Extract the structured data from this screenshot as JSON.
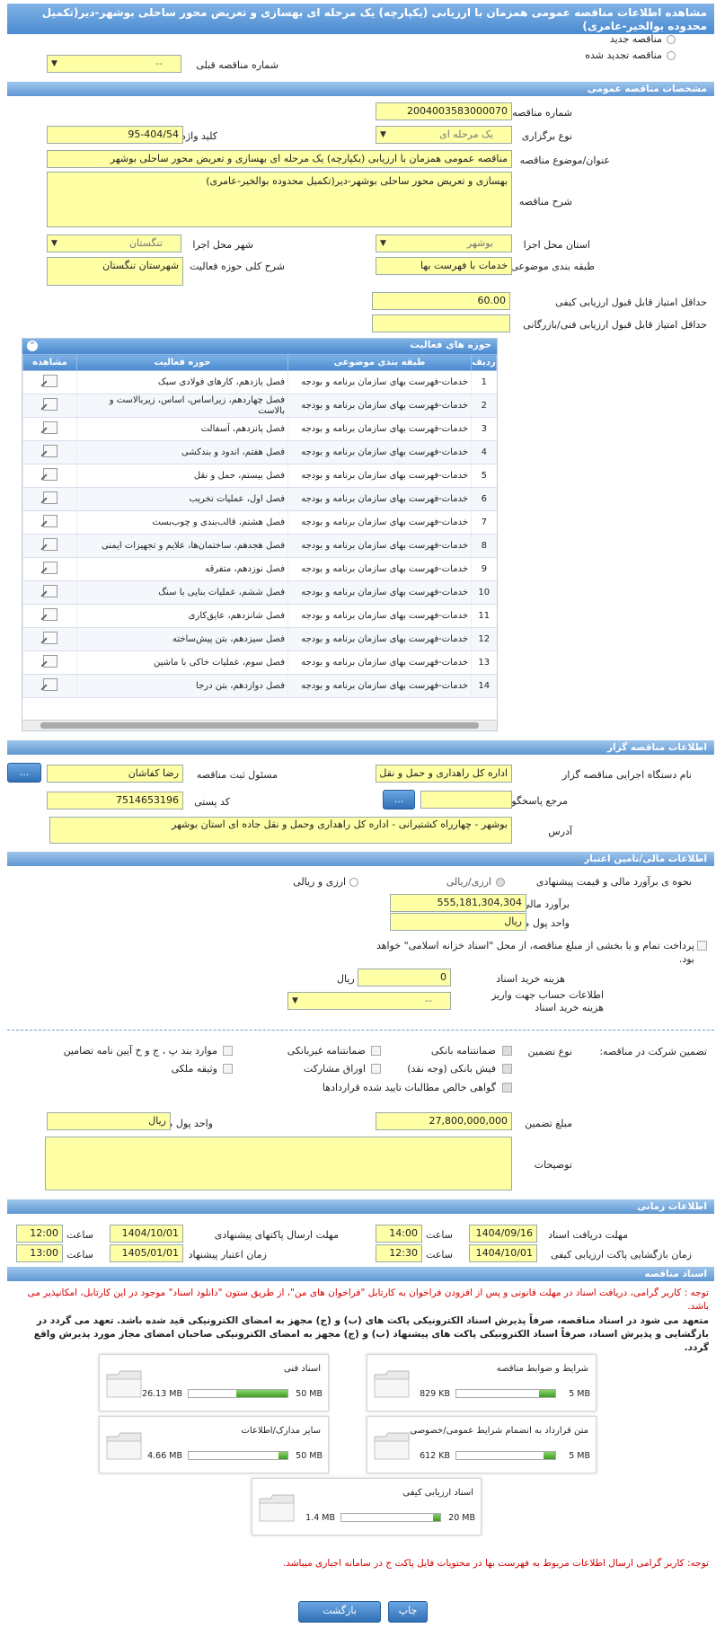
{
  "page_title": "مشاهده اطلاعات مناقصه عمومی همزمان با ارزیابی (یکپارچه) یک مرحله ای بهسازی و تعریض محور ساحلی بوشهر-دیر(تکمیل محدوده بوالخیر-عامری)",
  "top": {
    "new_tender": "مناقصه جدید",
    "renewed_tender": "مناقصه تجدید شده",
    "prev_number_label": "شماره مناقصه قبلی",
    "prev_number_value": "--"
  },
  "general": {
    "header": "مشخصات مناقصه عمومی",
    "number_label": "شماره مناقصه",
    "number_value": "2004003583000070",
    "type_label": "نوع برگزاری",
    "type_value": "یک مرحله ای",
    "keyword_label": "کلید واژه",
    "keyword_value": "95-404/54",
    "subject_label": "عنوان/موضوع مناقصه",
    "subject_value": "مناقصه عمومی همزمان با ارزیابی (یکپارچه) یک مرحله ای بهسازی و تعریض محور ساحلی بوشهر",
    "desc_label": "شرح مناقصه",
    "desc_value": "بهسازی و تعریض محور ساحلی بوشهر-دیر(تکمیل محدوده بوالخیر-عامری)",
    "province_label": "استان محل اجرا",
    "province_value": "بوشهر",
    "city_label": "شهر محل اجرا",
    "city_value": "تنگستان",
    "category_label": "طبقه بندی موضوعی",
    "category_value": "خدمات با فهرست بها",
    "activity_desc_label": "شرح کلی حوزه فعالیت",
    "activity_desc_value": "شهرستان تنگستان",
    "min_quality_label": "حداقل امتیاز قابل قبول ارزیابی کیفی",
    "min_quality_value": "60.00",
    "min_tech_label": "حداقل امتیاز قابل قبول ارزیابی فنی/بازرگانی",
    "min_tech_value": ""
  },
  "activities": {
    "header": "حوزه های فعالیت",
    "col_row": "ردیف",
    "col_category": "طبقه بندی موضوعی",
    "col_activity": "حوزه فعالیت",
    "col_view": "مشاهده",
    "rows": [
      {
        "n": "1",
        "cat": "خدمات-فهرست بهای سازمان برنامه و بودجه",
        "act": "فصل یازدهم، کارهای فولادی سبک"
      },
      {
        "n": "2",
        "cat": "خدمات-فهرست بهای سازمان برنامه و بودجه",
        "act": "فصل چهاردهم، زیراساس، اساس، زیربالاست و بالاست"
      },
      {
        "n": "3",
        "cat": "خدمات-فهرست بهای سازمان برنامه و بودجه",
        "act": "فصل پانزدهم، آسفالت"
      },
      {
        "n": "4",
        "cat": "خدمات-فهرست بهای سازمان برنامه و بودجه",
        "act": "فصل هفتم، اندود و بندکشی"
      },
      {
        "n": "5",
        "cat": "خدمات-فهرست بهای سازمان برنامه و بودجه",
        "act": "فصل بیستم، حمل و نقل"
      },
      {
        "n": "6",
        "cat": "خدمات-فهرست بهای سازمان برنامه و بودجه",
        "act": "فصل اول، عملیات تخریب"
      },
      {
        "n": "7",
        "cat": "خدمات-فهرست بهای سازمان برنامه و بودجه",
        "act": "فصل هشتم، قالب‌بندی و چوب‌بست"
      },
      {
        "n": "8",
        "cat": "خدمات-فهرست بهای سازمان برنامه و بودجه",
        "act": "فصل هجدهم، ساختمان‌ها، علایم و تجهیزات ایمنی"
      },
      {
        "n": "9",
        "cat": "خدمات-فهرست بهای سازمان برنامه و بودجه",
        "act": "فصل نوزدهم، متفرقه"
      },
      {
        "n": "10",
        "cat": "خدمات-فهرست بهای سازمان برنامه و بودجه",
        "act": "فصل ششم، عملیات بنایی با سنگ"
      },
      {
        "n": "11",
        "cat": "خدمات-فهرست بهای سازمان برنامه و بودجه",
        "act": "فصل شانزدهم، عایق‌کاری"
      },
      {
        "n": "12",
        "cat": "خدمات-فهرست بهای سازمان برنامه و بودجه",
        "act": "فصل سیزدهم، بتن پیش‌ساخته"
      },
      {
        "n": "13",
        "cat": "خدمات-فهرست بهای سازمان برنامه و بودجه",
        "act": "فصل سوم، عملیات خاکی با ماشین"
      },
      {
        "n": "14",
        "cat": "خدمات-فهرست بهای سازمان برنامه و بودجه",
        "act": "فصل دوازدهم، بتن درجا"
      }
    ]
  },
  "organizer": {
    "header": "اطلاعات مناقصه گزار",
    "org_label": "نام دستگاه اجرایی مناقصه گزار",
    "org_value": "اداره کل راهداری و حمل و نقل",
    "resp_label": "مسئول ثبت مناقصه",
    "resp_value": "رضا کفاشان",
    "resp_btn": "...",
    "ref_label": "مرجع پاسخگویی",
    "ref_value": "",
    "ref_btn": "...",
    "postal_label": "کد پستی",
    "postal_value": "7514653196",
    "address_label": "آدرس",
    "address_value": "بوشهر - چهارراه کشتیرانی - اداره کل راهداری وحمل و نقل جاده ای استان بوشهر"
  },
  "finance": {
    "header": "اطلاعات مالی/تامین اعتبار",
    "method_label": "نحوه ی برآورد مالی و قیمت پیشنهادی",
    "opt_rial": "ارزی/ریالی",
    "opt_both": "ارزی و ریالی",
    "estimate_label": "برآورد مالی",
    "estimate_value": "555,181,304,304",
    "currency_label": "واحد پول مالی",
    "currency_value": "ریال",
    "treasury_text": "پرداخت تمام و یا بخشی از مبلغ مناقصه، از محل \"اسناد خزانه اسلامی\" خواهد بود.",
    "doc_cost_label": "هزینه خرید اسناد",
    "doc_cost_value": "0",
    "doc_cost_unit": "ریال",
    "account_label": "اطلاعات حساب جهت واریز هزینه خرید اسناد",
    "account_value": "--"
  },
  "guarantee": {
    "label": "تضمین شرکت در مناقصه:",
    "type_label": "نوع تضمین",
    "bank": "ضمانتنامه بانکی",
    "nonbank": "ضمانتنامه غیربانکی",
    "clauses": "موارد بند پ ، ج و خ آیین نامه تضامین",
    "cheque": "فیش بانکی (وجه نقد)",
    "bonds": "اوراق مشارکت",
    "property": "وثیقه ملکی",
    "claims": "گواهی خالص مطالبات تایید شده قراردادها",
    "amount_label": "مبلغ تضمین",
    "amount_value": "27,800,000,000",
    "unit_label": "واحد پول مالی",
    "unit_value": "ریال",
    "notes_label": "توضیحات",
    "notes_value": ""
  },
  "timing": {
    "header": "اطلاعات زمانی",
    "receive_label": "مهلت دریافت اسناد",
    "receive_date": "1404/09/16",
    "receive_time": "14:00",
    "send_label": "مهلت ارسال پاکتهای پیشنهادی",
    "send_date": "1404/10/01",
    "send_time": "12:00",
    "open_label": "زمان بازگشایی پاکت ارزیابی کیفی",
    "open_date": "1404/10/01",
    "open_time": "12:30",
    "valid_label": "زمان اعتبار پیشنهاد",
    "valid_date": "1405/01/01",
    "valid_time": "13:00",
    "time_label": "ساعت"
  },
  "docs": {
    "header": "اسناد مناقصه",
    "note1": "توجه : کاربر گرامی، دریافت اسناد در مهلت قانونی و پس از افزودن فراخوان به کارتابل \"فراخوان های من\"، از طریق ستون \"دانلود اسناد\" موجود در این کارتابل، امکانپذیر می باشد.",
    "note2": "متعهد می شود در اسناد مناقصه، صرفاً پذیرش اسناد الکترونیکی پاکت های (ب) و (ج) مجهز به امضای الکترونیکی قید شده باشد. تعهد می گردد در بازگشایی و پذیرش اسناد، صرفاً اسناد الکترونیکی پاکت های پیشنهاد (ب) و (ج) مجهز به امضای الکترونیکی صاحبان امضای مجاز مورد پذیرش واقع گردد.",
    "files": [
      {
        "title": "شرایط و ضوابط مناقصه",
        "size": "829 KB",
        "max": "5 MB",
        "fill": 0.16
      },
      {
        "title": "اسناد فنی",
        "size": "26.13 MB",
        "max": "50 MB",
        "fill": 0.52
      },
      {
        "title": "متن قرارداد به انضمام شرایط عمومی/خصوصی",
        "size": "612 KB",
        "max": "5 MB",
        "fill": 0.12
      },
      {
        "title": "سایر مدارک/اطلاعات",
        "size": "4.66 MB",
        "max": "50 MB",
        "fill": 0.09
      },
      {
        "title": "اسناد ارزیابی کیفی",
        "size": "1.4 MB",
        "max": "20 MB",
        "fill": 0.07
      }
    ],
    "note3": "توجه: کاربر گرامی ارسال اطلاعات مربوط به فهرست بها در محتویات فایل پاکت ج در سامانه اجباری میباشد."
  },
  "buttons": {
    "print": "چاپ",
    "back": "بازگشت"
  }
}
